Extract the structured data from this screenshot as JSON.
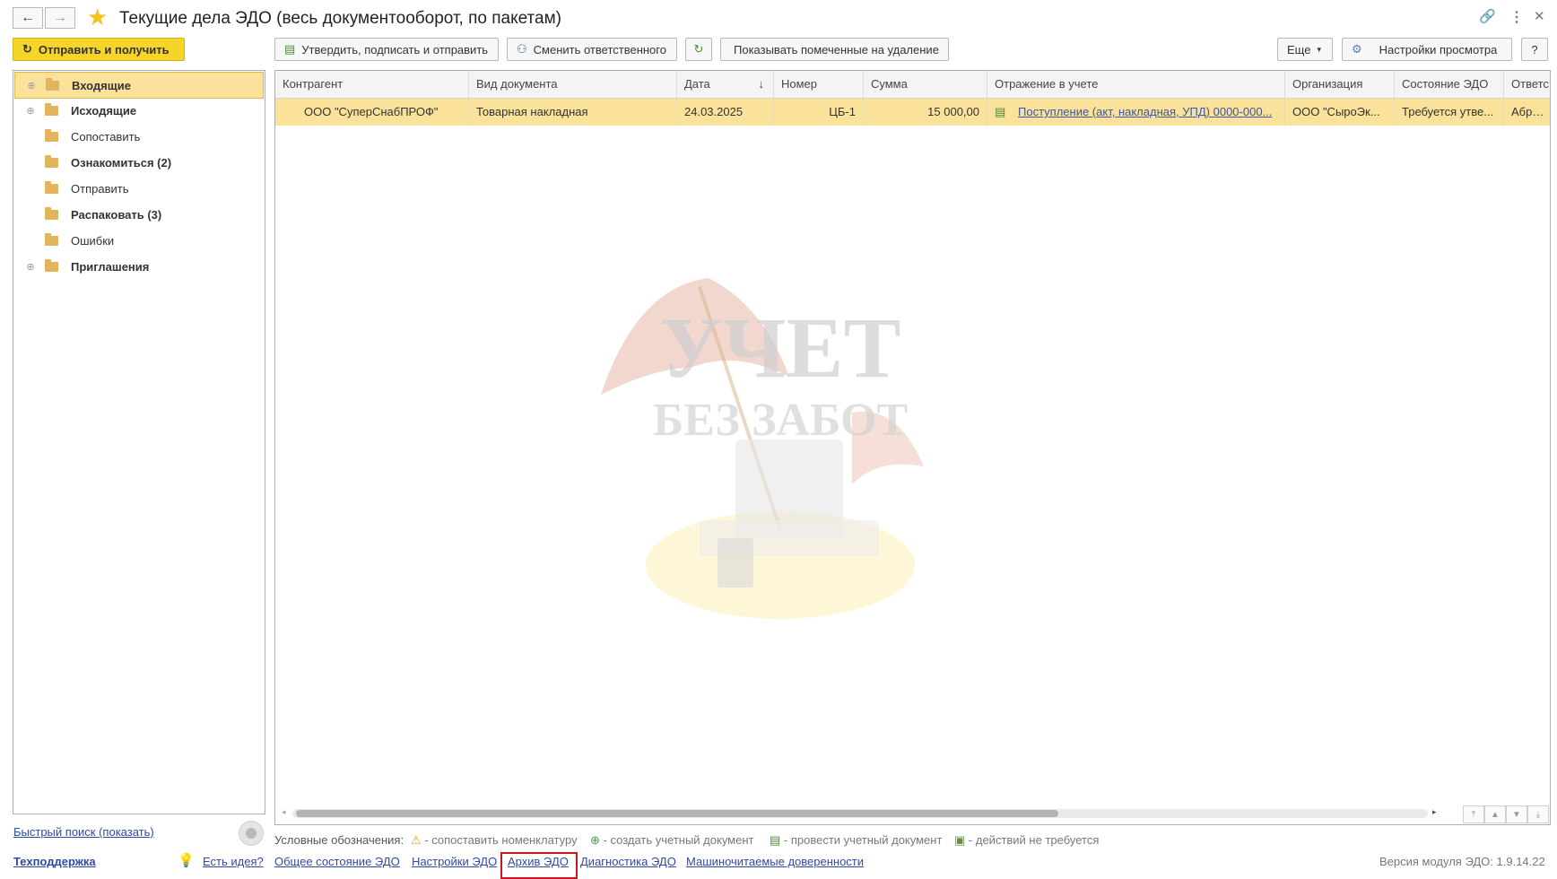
{
  "window": {
    "title": "Текущие дела ЭДО (весь документооборот, по пакетам)",
    "icons": [
      "back-arrow-icon",
      "forward-arrow-icon",
      "favorite-star-icon",
      "link-icon",
      "more-icon",
      "close-icon"
    ]
  },
  "toolbar": {
    "send_receive": "Отправить и получить",
    "approve_sign_send": "Утвердить, подписать и отправить",
    "change_responsible": "Сменить ответственного",
    "show_marked": "Показывать помеченные на удаление",
    "more": "Еще",
    "view_settings": "Настройки просмотра",
    "help": "?"
  },
  "tree": {
    "items": [
      {
        "label": "Входящие",
        "bold": true,
        "expandable": true,
        "selected": true
      },
      {
        "label": "Исходящие",
        "bold": true,
        "expandable": true,
        "selected": false
      },
      {
        "label": "Сопоставить",
        "bold": false,
        "expandable": false,
        "selected": false
      },
      {
        "label": "Ознакомиться (2)",
        "bold": true,
        "expandable": false,
        "selected": false
      },
      {
        "label": "Отправить",
        "bold": false,
        "expandable": false,
        "selected": false
      },
      {
        "label": "Распаковать (3)",
        "bold": true,
        "expandable": false,
        "selected": false
      },
      {
        "label": "Ошибки",
        "bold": false,
        "expandable": false,
        "selected": false
      },
      {
        "label": "Приглашения",
        "bold": true,
        "expandable": true,
        "selected": false
      }
    ]
  },
  "table": {
    "columns": [
      "Контрагент",
      "Вид документа",
      "Дата",
      "Номер",
      "Сумма",
      "Отражение в учете",
      "Организация",
      "Состояние ЭДО",
      "Ответс"
    ],
    "sort_indicator": "↓",
    "rows": [
      [
        "ООО \"СуперСнабПРОФ\"",
        "Товарная накладная",
        "24.03.2025",
        "ЦБ-1",
        "15 000,00",
        "Поступление (акт, накладная, УПД) 0000-000...",
        "ООО \"СыроЭк...",
        "Требуется утве...",
        "Абрамо"
      ]
    ]
  },
  "watermark": {
    "line1": "УЧЕТ",
    "line2": "БЕЗ ЗАБОТ"
  },
  "footer": {
    "quick_search": "Быстрый поиск (показать)",
    "legend_title": "Условные обозначения:",
    "legend_items": [
      {
        "icon": "warning-icon",
        "text": "- сопоставить номенклатуру"
      },
      {
        "icon": "add-circle-icon",
        "text": "- создать учетный документ"
      },
      {
        "icon": "post-document-icon",
        "text": "- провести учетный документ"
      },
      {
        "icon": "no-action-icon",
        "text": "- действий не требуется"
      }
    ],
    "support": "Техподдержка",
    "links": [
      "Есть идея?",
      "Общее состояние ЭДО",
      "Настройки ЭДО",
      "Архив ЭДО",
      "Диагностика ЭДО",
      "Машиночитаемые доверенности"
    ],
    "version": "Версия модуля ЭДО: 1.9.14.22"
  },
  "colors": {
    "selection": "#fbe29a",
    "accent_button": "#f6d529",
    "link": "#2f4aa2",
    "highlight_frame": "#c8181f"
  }
}
